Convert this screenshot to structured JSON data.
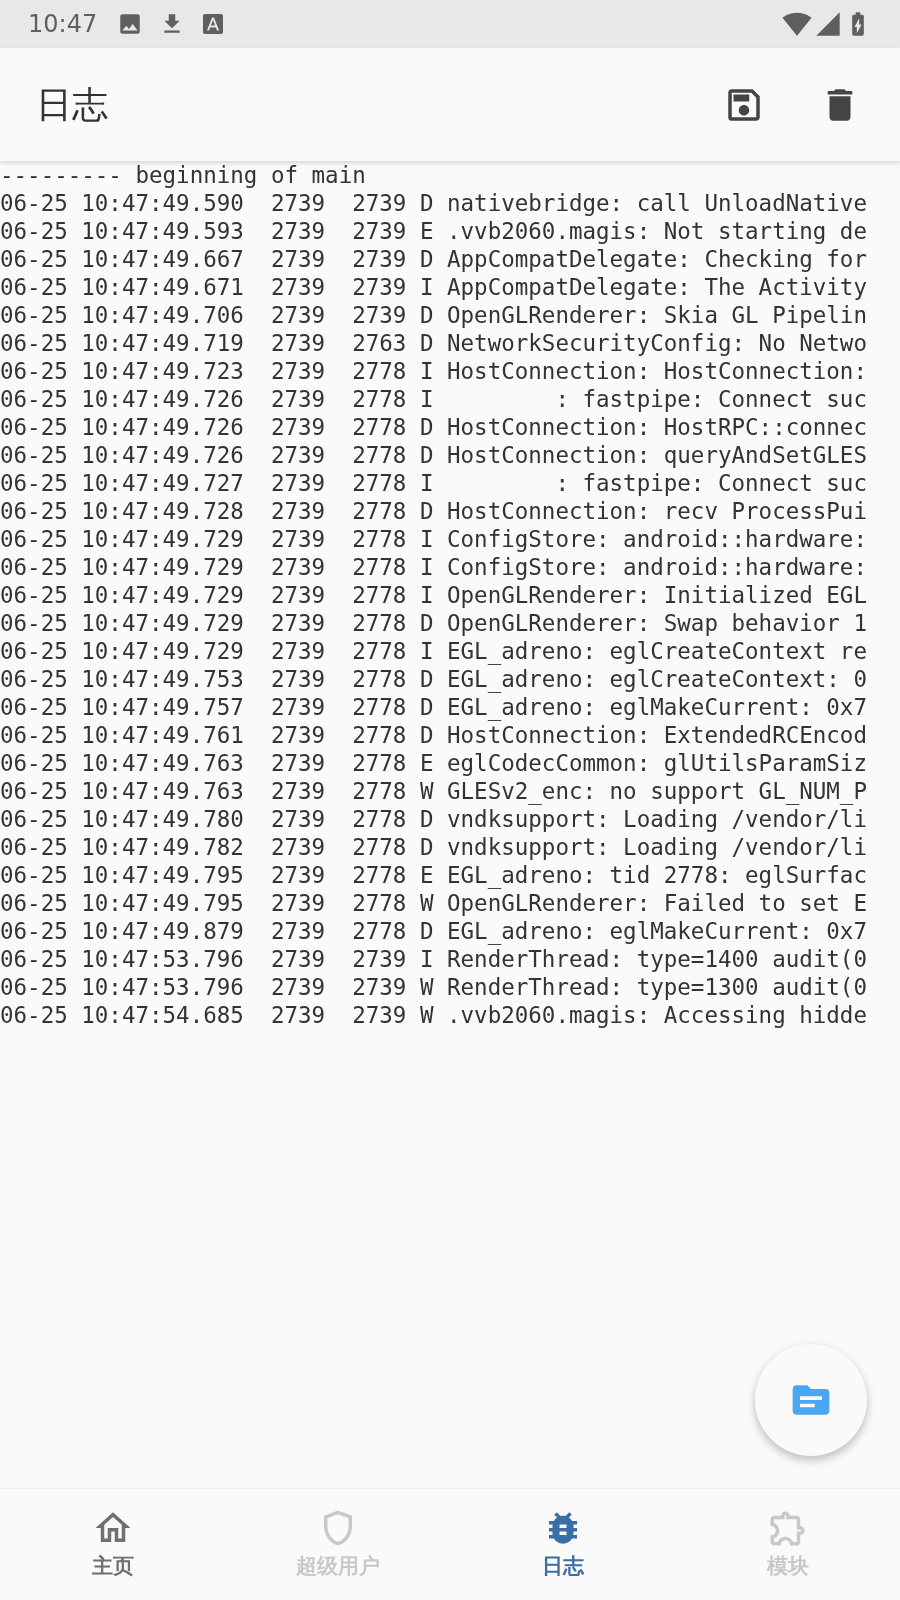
{
  "status_bar": {
    "time": "10:47"
  },
  "app_bar": {
    "title": "日志"
  },
  "log_lines": [
    "--------- beginning of main",
    "06-25 10:47:49.590  2739  2739 D nativebridge: call UnloadNative",
    "06-25 10:47:49.593  2739  2739 E .vvb2060.magis: Not starting de",
    "06-25 10:47:49.667  2739  2739 D AppCompatDelegate: Checking for",
    "06-25 10:47:49.671  2739  2739 I AppCompatDelegate: The Activity",
    "06-25 10:47:49.706  2739  2739 D OpenGLRenderer: Skia GL Pipelin",
    "06-25 10:47:49.719  2739  2763 D NetworkSecurityConfig: No Netwo",
    "06-25 10:47:49.723  2739  2778 I HostConnection: HostConnection:",
    "06-25 10:47:49.726  2739  2778 I         : fastpipe: Connect suc",
    "06-25 10:47:49.726  2739  2778 D HostConnection: HostRPC::connec",
    "06-25 10:47:49.726  2739  2778 D HostConnection: queryAndSetGLES",
    "06-25 10:47:49.727  2739  2778 I         : fastpipe: Connect suc",
    "06-25 10:47:49.728  2739  2778 D HostConnection: recv ProcessPui",
    "06-25 10:47:49.729  2739  2778 I ConfigStore: android::hardware:",
    "06-25 10:47:49.729  2739  2778 I ConfigStore: android::hardware:",
    "06-25 10:47:49.729  2739  2778 I OpenGLRenderer: Initialized EGL",
    "06-25 10:47:49.729  2739  2778 D OpenGLRenderer: Swap behavior 1",
    "06-25 10:47:49.729  2739  2778 I EGL_adreno: eglCreateContext re",
    "06-25 10:47:49.753  2739  2778 D EGL_adreno: eglCreateContext: 0",
    "06-25 10:47:49.757  2739  2778 D EGL_adreno: eglMakeCurrent: 0x7",
    "06-25 10:47:49.761  2739  2778 D HostConnection: ExtendedRCEncod",
    "06-25 10:47:49.763  2739  2778 E eglCodecCommon: glUtilsParamSiz",
    "06-25 10:47:49.763  2739  2778 W GLESv2_enc: no support GL_NUM_P",
    "06-25 10:47:49.780  2739  2778 D vndksupport: Loading /vendor/li",
    "06-25 10:47:49.782  2739  2778 D vndksupport: Loading /vendor/li",
    "06-25 10:47:49.795  2739  2778 E EGL_adreno: tid 2778: eglSurfac",
    "06-25 10:47:49.795  2739  2778 W OpenGLRenderer: Failed to set E",
    "06-25 10:47:49.879  2739  2778 D EGL_adreno: eglMakeCurrent: 0x7",
    "06-25 10:47:53.796  2739  2739 I RenderThread: type=1400 audit(0",
    "06-25 10:47:53.796  2739  2739 W RenderThread: type=1300 audit(0",
    "06-25 10:47:54.685  2739  2739 W .vvb2060.magis: Accessing hidde"
  ],
  "bottom_nav": [
    {
      "kind": "home",
      "label": "主页",
      "selected": false,
      "disabled": false
    },
    {
      "kind": "superuser",
      "label": "超级用户",
      "selected": false,
      "disabled": true
    },
    {
      "kind": "log",
      "label": "日志",
      "selected": true,
      "disabled": false
    },
    {
      "kind": "modules",
      "label": "模块",
      "selected": false,
      "disabled": true
    }
  ]
}
